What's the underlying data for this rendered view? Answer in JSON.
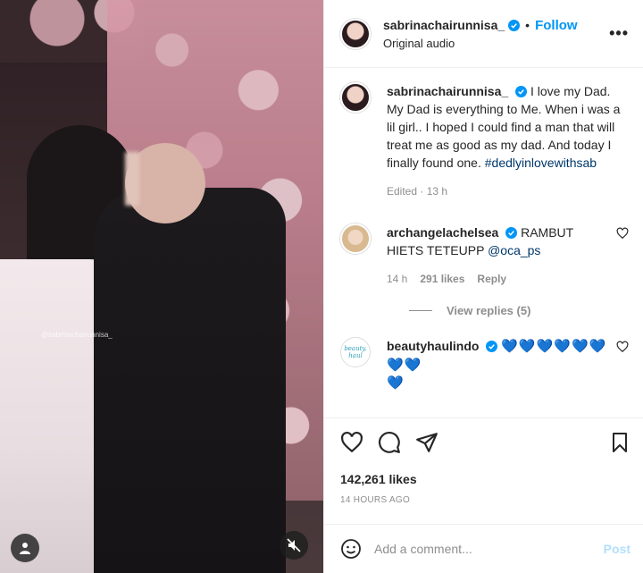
{
  "video": {
    "watermark": "@sabrinachairunnisa_"
  },
  "header": {
    "username": "sabrinachairunnisa_",
    "separator": "•",
    "follow_label": "Follow",
    "audio_label": "Original audio",
    "more_label": "•••"
  },
  "caption": {
    "username": "sabrinachairunnisa_",
    "text": "I love my Dad. My Dad is everything to Me. When i was a lil girl.. I hoped I could find a man that will treat me as good as my dad. And today I finally found one.",
    "hashtag": "#dedlyinlovewithsab",
    "meta": "Edited · 13 h"
  },
  "comments": [
    {
      "username": "archangelachelsea",
      "text": "RAMBUT HIETS TETEUPP",
      "mention": "@oca_ps",
      "time": "14 h",
      "likes": "291 likes",
      "reply_label": "Reply",
      "view_replies": "View replies (5)"
    },
    {
      "username": "beautyhaulindo",
      "avatar_text": "beauty. haul",
      "hearts_line1": "💙💙💙💙💙💙💙💙",
      "hearts_line2": "💙"
    }
  ],
  "actions": {
    "likes": "142,261 likes",
    "timestamp": "14 HOURS AGO"
  },
  "composer": {
    "placeholder": "Add a comment...",
    "post_label": "Post"
  },
  "colors": {
    "accent": "#0095f6",
    "hashtag": "#00376b",
    "muted": "#8e8e8e",
    "hearts": "#17a8b8",
    "post_disabled": "#b2dffc"
  }
}
